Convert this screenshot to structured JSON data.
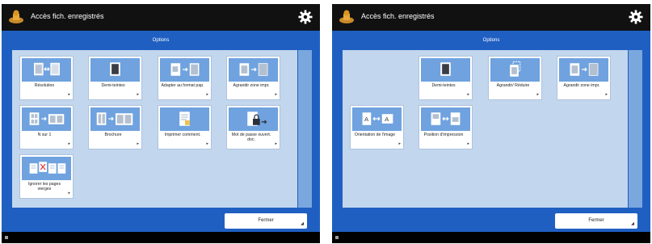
{
  "colors": {
    "topbar": "#111111",
    "options_bar": "#1f5fc2",
    "content_area": "#c2d6ee",
    "scrollbar": "#7aa7de",
    "tile_icon_background": "#6fa2df",
    "tile_background": "#ffffff"
  },
  "left_panel": {
    "app_icon": "stamp-icon",
    "title": "Accès fich. enregistrés",
    "settings_icon": "gear-icon",
    "options_title": "Options",
    "tiles": [
      {
        "label": "Résolution",
        "icon": "resolution-icon"
      },
      {
        "label": "Demi-teintes",
        "icon": "halftone-icon"
      },
      {
        "label": "Adapter au format pap.",
        "icon": "fit-to-paper-icon"
      },
      {
        "label": "Agrandir zone impr.",
        "icon": "enlarge-print-area-icon"
      },
      {
        "label": "N sur 1",
        "icon": "n-on-1-icon"
      },
      {
        "label": "Brochure",
        "icon": "booklet-icon"
      },
      {
        "label": "Imprimer comment.",
        "icon": "print-comments-icon"
      },
      {
        "label": "Mot de passe ouvert. doc.",
        "icon": "document-password-icon"
      },
      {
        "label": "Ignorer les pages vierges",
        "icon": "skip-blank-pages-icon"
      }
    ],
    "close_label": "Fermer"
  },
  "right_panel": {
    "app_icon": "stamp-icon",
    "title": "Accès fich. enregistrés",
    "settings_icon": "gear-icon",
    "options_title": "Options",
    "tiles": [
      {
        "label": "Demi-teintes",
        "icon": "halftone-icon"
      },
      {
        "label": "Agrandir/ Réduire",
        "icon": "enlarge-reduce-icon"
      },
      {
        "label": "Agrandir zone impr.",
        "icon": "enlarge-print-area-icon"
      },
      {
        "label": "Orientation de l'image",
        "icon": "image-orientation-icon"
      },
      {
        "label": "Position d'impression",
        "icon": "print-position-icon"
      }
    ],
    "close_label": "Fermer"
  }
}
